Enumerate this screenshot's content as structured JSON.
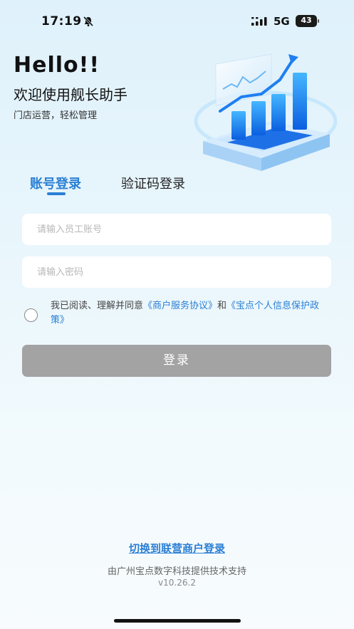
{
  "status_bar": {
    "time": "17:19",
    "network": "5G",
    "battery": "43"
  },
  "header": {
    "greeting": "Hello!!",
    "welcome": "欢迎使用舰长助手",
    "subtitle": "门店运营，轻松管理"
  },
  "tabs": [
    {
      "label": "账号登录",
      "active": true
    },
    {
      "label": "验证码登录",
      "active": false
    }
  ],
  "form": {
    "account_placeholder": "请输入员工账号",
    "password_placeholder": "请输入密码",
    "agreement": {
      "prefix": "我已阅读、理解并同意",
      "link1": "《商户服务协议》",
      "and": "和",
      "link2": "《宝点个人信息保护政策》",
      "checked": false
    },
    "login_label": "登录"
  },
  "footer": {
    "switch_link": "切换到联营商户登录",
    "support": "由广州宝点数字科技提供技术支持",
    "version": "v10.26.2"
  },
  "colors": {
    "accent": "#2a7fd4",
    "button_disabled": "#a3a3a3"
  },
  "icons": [
    "bell-muted-icon",
    "signal-icon",
    "battery-icon",
    "radio-icon"
  ]
}
